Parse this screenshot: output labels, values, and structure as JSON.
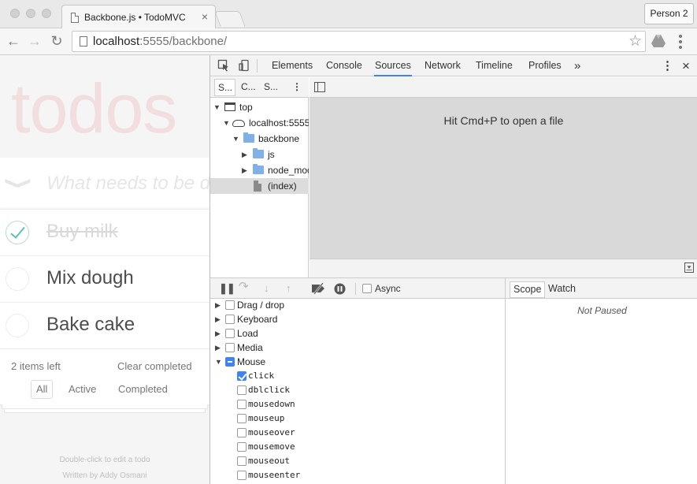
{
  "browser": {
    "tab_title": "Backbone.js • TodoMVC",
    "tab_close": "×",
    "profile_button": "Person 2",
    "url_host": "localhost",
    "url_rest": ":5555/backbone/",
    "back_glyph": "←",
    "forward_glyph": "→",
    "reload_glyph": "↻",
    "star_glyph": "☆"
  },
  "todo": {
    "title": "todos",
    "toggle_all_glyph": "❯",
    "new_todo_placeholder": "What needs to be done?",
    "items": [
      {
        "label": "Buy milk",
        "completed": true
      },
      {
        "label": "Mix dough",
        "completed": false
      },
      {
        "label": "Bake cake",
        "completed": false
      }
    ],
    "items_left": "2 items left",
    "clear_completed": "Clear completed",
    "filters": [
      "All",
      "Active",
      "Completed"
    ],
    "selected_filter": "All",
    "info_edit": "Double-click to edit a todo",
    "info_author": "Written by Addy Osmani"
  },
  "devtools": {
    "tabs": [
      "Elements",
      "Console",
      "Sources",
      "Network",
      "Timeline",
      "Profiles"
    ],
    "active_tab": "Sources",
    "more_glyph": "»",
    "kebab_glyph": "⋮",
    "close_glyph": "×",
    "navigator_subtabs": [
      "S...",
      "C...",
      "S..."
    ],
    "tree": [
      {
        "label": "top",
        "type": "frame",
        "expanded": true
      },
      {
        "label": "localhost:5555",
        "type": "domain",
        "expanded": true
      },
      {
        "label": "backbone",
        "type": "folder",
        "expanded": true
      },
      {
        "label": "js",
        "type": "folder",
        "expanded": false
      },
      {
        "label": "node_modules",
        "type": "folder",
        "expanded": false
      },
      {
        "label": "(index)",
        "type": "file",
        "selected": true
      }
    ],
    "editor_hint": "Hit Cmd+P to open a file",
    "async_label": "Async",
    "breakpoint_categories": [
      {
        "label": "Drag / drop",
        "expanded": false,
        "state": "unchecked"
      },
      {
        "label": "Keyboard",
        "expanded": false,
        "state": "unchecked"
      },
      {
        "label": "Load",
        "expanded": false,
        "state": "unchecked"
      },
      {
        "label": "Media",
        "expanded": false,
        "state": "unchecked"
      },
      {
        "label": "Mouse",
        "expanded": true,
        "state": "mixed"
      }
    ],
    "mouse_events": [
      {
        "label": "click",
        "checked": true
      },
      {
        "label": "dblclick",
        "checked": false
      },
      {
        "label": "mousedown",
        "checked": false
      },
      {
        "label": "mouseup",
        "checked": false
      },
      {
        "label": "mouseover",
        "checked": false
      },
      {
        "label": "mousemove",
        "checked": false
      },
      {
        "label": "mouseout",
        "checked": false
      },
      {
        "label": "mouseenter",
        "checked": false
      }
    ],
    "scope_tabs": [
      "Scope",
      "Watch"
    ],
    "active_scope_tab": "Scope",
    "not_paused": "Not Paused"
  },
  "colors": {
    "accent_blue": "#3e82f7",
    "todo_title": "#f2dede",
    "check_green": "#5dc2af"
  }
}
